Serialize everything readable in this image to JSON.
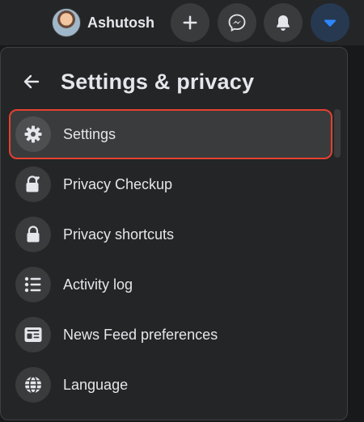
{
  "topbar": {
    "profile_name": "Ashutosh",
    "buttons": [
      {
        "name": "create",
        "icon": "plus-icon"
      },
      {
        "name": "messenger",
        "icon": "messenger-icon"
      },
      {
        "name": "notifications",
        "icon": "bell-icon"
      },
      {
        "name": "account",
        "icon": "caret-down-icon",
        "active": true
      }
    ],
    "active_color": "#2d88ff"
  },
  "panel": {
    "title": "Settings & privacy",
    "items": [
      {
        "label": "Settings",
        "icon": "gear-icon",
        "highlighted": true
      },
      {
        "label": "Privacy Checkup",
        "icon": "lock-heart-icon"
      },
      {
        "label": "Privacy shortcuts",
        "icon": "lock-icon"
      },
      {
        "label": "Activity log",
        "icon": "list-icon"
      },
      {
        "label": "News Feed preferences",
        "icon": "news-feed-icon"
      },
      {
        "label": "Language",
        "icon": "globe-icon"
      }
    ],
    "highlight_color": "#e4412f"
  }
}
